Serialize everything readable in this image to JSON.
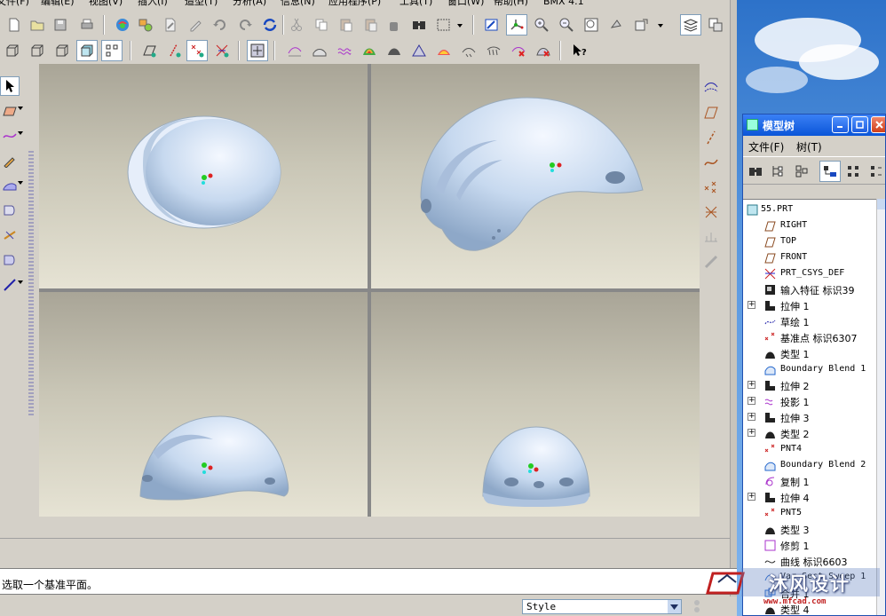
{
  "menubar": {
    "items": [
      "文件(F)",
      "编辑(E)",
      "视图(V)",
      "插入(I)",
      "造型(T)",
      "分析(A)",
      "信息(N)",
      "应用程序(P)",
      "工具(T)",
      "窗口(W)",
      "帮助(H)",
      "BMX 4.1"
    ]
  },
  "tree_panel": {
    "title": "模型树",
    "menu": [
      "文件(F)",
      "树(T)"
    ],
    "items": [
      {
        "label": "55.PRT",
        "icon": "part-icon",
        "expand": ""
      },
      {
        "label": "RIGHT",
        "icon": "datum-plane-icon",
        "expand": ""
      },
      {
        "label": "TOP",
        "icon": "datum-plane-icon",
        "expand": ""
      },
      {
        "label": "FRONT",
        "icon": "datum-plane-icon",
        "expand": ""
      },
      {
        "label": "PRT_CSYS_DEF",
        "icon": "csys-icon",
        "expand": ""
      },
      {
        "label": "输入特征 标识39",
        "icon": "import-feature-icon",
        "expand": ""
      },
      {
        "label": "拉伸 1",
        "icon": "extrude-icon",
        "expand": "+"
      },
      {
        "label": "草绘 1",
        "icon": "sketch-icon",
        "expand": ""
      },
      {
        "label": "基准点 标识6307",
        "icon": "datum-point-icon",
        "expand": ""
      },
      {
        "label": "类型 1",
        "icon": "type-feature-icon",
        "expand": ""
      },
      {
        "label": "Boundary Blend 1",
        "icon": "boundary-blend-icon",
        "expand": ""
      },
      {
        "label": "拉伸 2",
        "icon": "extrude-icon",
        "expand": "+"
      },
      {
        "label": "投影 1",
        "icon": "projection-icon",
        "expand": "+"
      },
      {
        "label": "拉伸 3",
        "icon": "extrude-icon",
        "expand": "+"
      },
      {
        "label": "类型 2",
        "icon": "type-feature-icon",
        "expand": "+"
      },
      {
        "label": "PNT4",
        "icon": "datum-point-icon",
        "expand": ""
      },
      {
        "label": "Boundary Blend 2",
        "icon": "boundary-blend-icon",
        "expand": ""
      },
      {
        "label": "复制 1",
        "icon": "copy-feature-icon",
        "expand": ""
      },
      {
        "label": "拉伸 4",
        "icon": "extrude-icon",
        "expand": "+"
      },
      {
        "label": "PNT5",
        "icon": "datum-point-icon",
        "expand": ""
      },
      {
        "label": "类型 3",
        "icon": "type-feature-icon",
        "expand": ""
      },
      {
        "label": "修剪 1",
        "icon": "trim-icon",
        "expand": ""
      },
      {
        "label": "曲线 标识6603",
        "icon": "curve-icon",
        "expand": ""
      },
      {
        "label": "Var Sect Sweep 1",
        "icon": "sweep-icon",
        "expand": ""
      },
      {
        "label": "合并 1",
        "icon": "merge-icon",
        "expand": ""
      },
      {
        "label": "类型 4",
        "icon": "type-feature-icon",
        "expand": ""
      }
    ]
  },
  "message": {
    "text": "选取一个基准平面。"
  },
  "status": {
    "style_value": "Style"
  },
  "watermark": {
    "text": "沐风设计",
    "url": "www.mfcad.com"
  },
  "colors": {
    "helmet": "#c7d9ef",
    "helmet_shadow": "#8ea8c8",
    "viewport_top": "#a9a597",
    "viewport_bottom": "#e6e3d4",
    "titlebar": "#0a55d8"
  }
}
